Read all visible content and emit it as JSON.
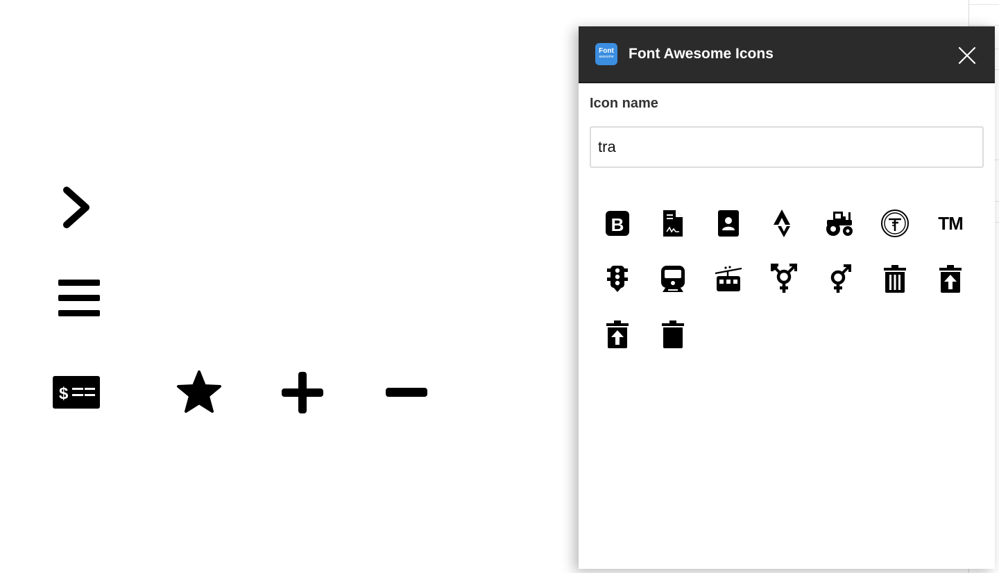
{
  "canvas": {
    "icons": [
      "chevron-right-icon",
      "bars-icon",
      "money-check-icon",
      "star-icon",
      "plus-icon",
      "minus-icon"
    ]
  },
  "panel": {
    "logo": {
      "line1": "Font",
      "line2": "awesome",
      "color": "#3b8ee0"
    },
    "title": "Font Awesome Icons",
    "header_color": "#2b2b2b",
    "close_icon": "close-icon"
  },
  "search": {
    "label": "Icon name",
    "value": "tra"
  },
  "results": [
    {
      "name": "bootstrap-icon"
    },
    {
      "name": "file-contract-icon"
    },
    {
      "name": "address-book-icon"
    },
    {
      "name": "strava-icon"
    },
    {
      "name": "tractor-icon"
    },
    {
      "name": "tumblr-circle-icon"
    },
    {
      "name": "trademark-icon",
      "text": "TM"
    },
    {
      "name": "traffic-light-icon"
    },
    {
      "name": "train-icon"
    },
    {
      "name": "tram-icon"
    },
    {
      "name": "transgender-alt-icon"
    },
    {
      "name": "transgender-icon"
    },
    {
      "name": "trash-alt-icon"
    },
    {
      "name": "trash-restore-icon"
    },
    {
      "name": "trash-restore-alt-icon"
    },
    {
      "name": "trash-icon"
    }
  ]
}
